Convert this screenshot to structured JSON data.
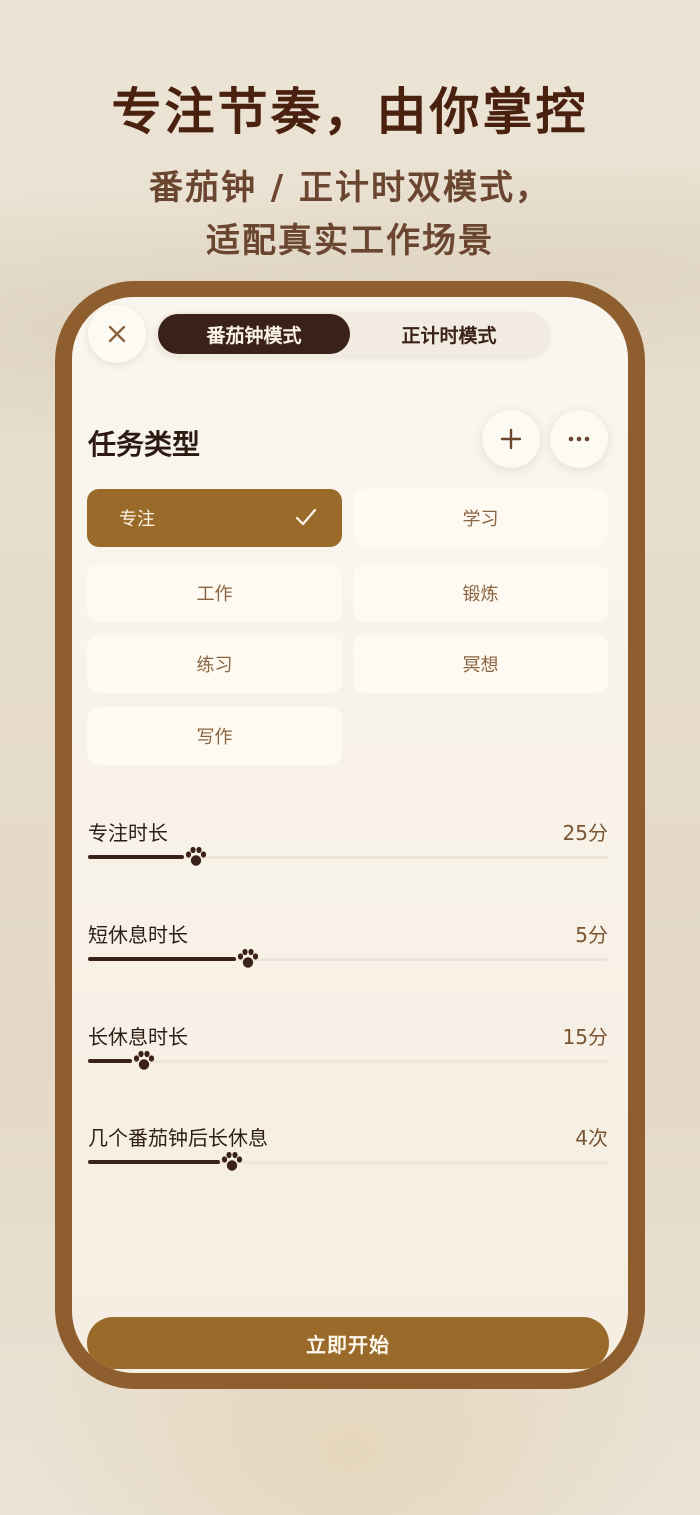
{
  "promo": {
    "headline": "专注节奏，由你掌控",
    "subline_1": "番茄钟 / 正计时双模式，",
    "subline_2": "适配真实工作场景"
  },
  "header": {
    "close_icon": "close-icon",
    "modes": [
      {
        "label": "番茄钟模式",
        "active": true
      },
      {
        "label": "正计时模式",
        "active": false
      }
    ]
  },
  "task_types": {
    "title": "任务类型",
    "add_icon": "plus-icon",
    "more_icon": "ellipsis-icon",
    "items": [
      {
        "label": "专注",
        "selected": true
      },
      {
        "label": "学习",
        "selected": false
      },
      {
        "label": "工作",
        "selected": false
      },
      {
        "label": "锻炼",
        "selected": false
      },
      {
        "label": "练习",
        "selected": false
      },
      {
        "label": "冥想",
        "selected": false
      },
      {
        "label": "写作",
        "selected": false
      }
    ]
  },
  "settings": [
    {
      "label": "专注时长",
      "value": "25分",
      "level": 0.2
    },
    {
      "label": "短休息时长",
      "value": "5分",
      "level": 0.3
    },
    {
      "label": "长休息时长",
      "value": "15分",
      "level": 0.1
    },
    {
      "label": "几个番茄钟后长休息",
      "value": "4次",
      "level": 0.27
    }
  ],
  "start_button": {
    "label": "立即开始"
  },
  "colors": {
    "accent": "#9a6a2a",
    "dark": "#3b2219",
    "frame": "#8f5e2f"
  }
}
